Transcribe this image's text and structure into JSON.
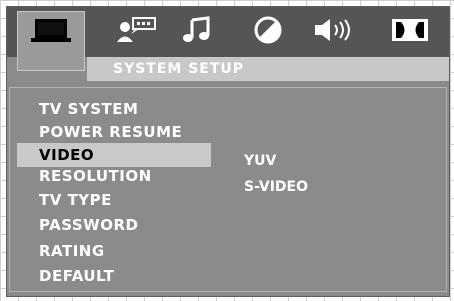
{
  "tabs": [
    {
      "name": "monitor",
      "active": true
    },
    {
      "name": "language"
    },
    {
      "name": "audio"
    },
    {
      "name": "video"
    },
    {
      "name": "speaker"
    },
    {
      "name": "dolby"
    }
  ],
  "title": "SYSTEM SETUP",
  "menu": [
    "TV SYSTEM",
    "POWER RESUME",
    "VIDEO",
    "RESOLUTION",
    "TV TYPE",
    "PASSWORD",
    "RATING",
    "DEFAULT"
  ],
  "selected_index": 2,
  "options": [
    "YUV",
    "S-VIDEO"
  ]
}
